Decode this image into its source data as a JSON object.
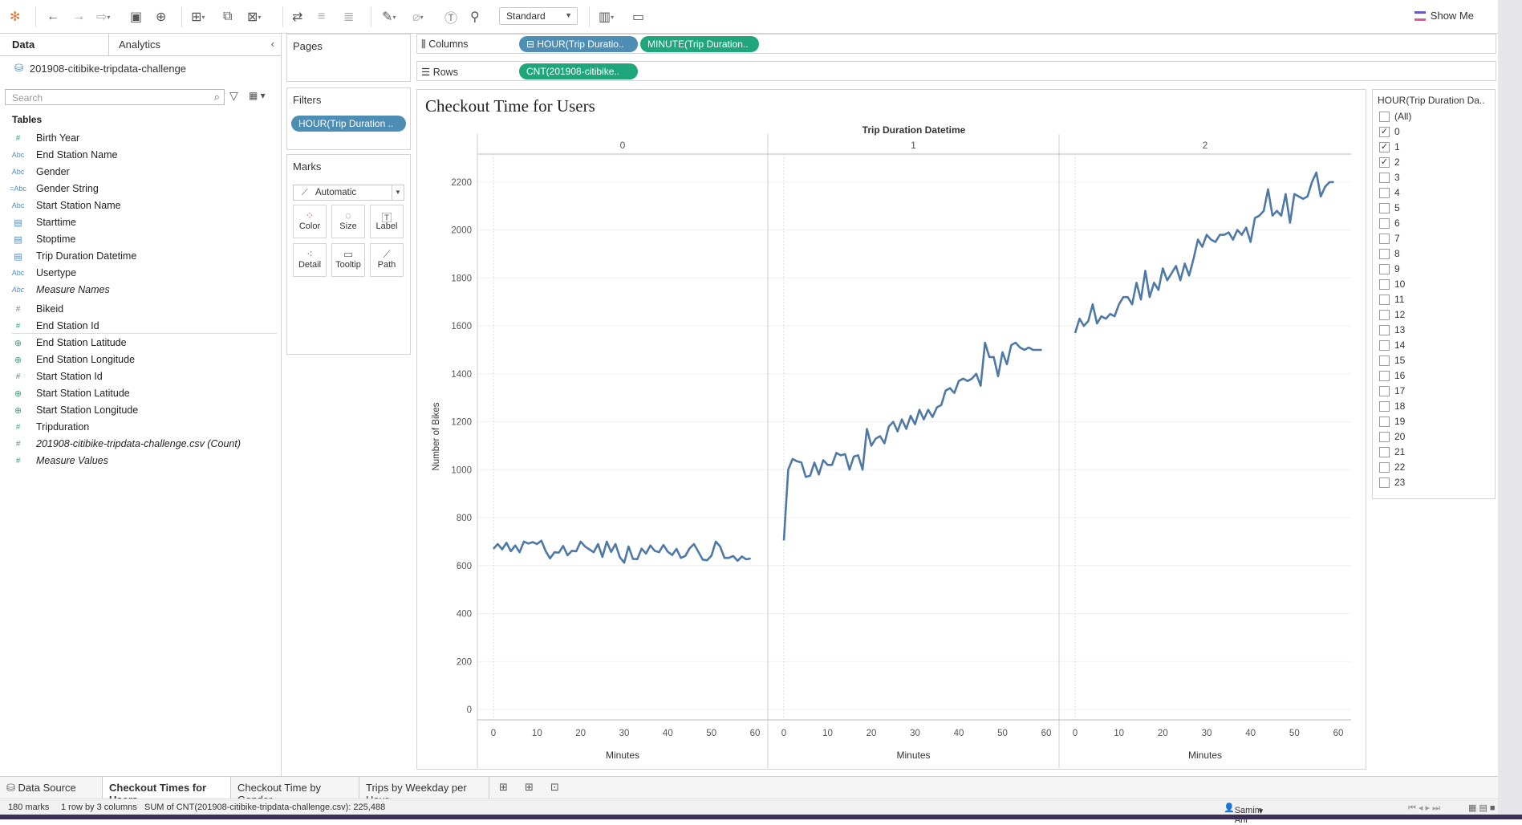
{
  "toolbar": {
    "view_mode": "Standard",
    "show_me": "Show Me"
  },
  "data_pane": {
    "tab_data": "Data",
    "tab_analytics": "Analytics",
    "datasource": "201908-citibike-tripdata-challenge",
    "search_placeholder": "Search",
    "tables_heading": "Tables",
    "dimensions": [
      {
        "name": "Birth Year",
        "type": "#"
      },
      {
        "name": "End Station Name",
        "type": "Abc"
      },
      {
        "name": "Gender",
        "type": "Abc"
      },
      {
        "name": "Gender String",
        "type": "=Abc"
      },
      {
        "name": "Start Station Name",
        "type": "Abc"
      },
      {
        "name": "Starttime",
        "type": "cal"
      },
      {
        "name": "Stoptime",
        "type": "cal"
      },
      {
        "name": "Trip Duration Datetime",
        "type": "cal"
      },
      {
        "name": "Usertype",
        "type": "Abc"
      },
      {
        "name": "Measure Names",
        "type": "Abc"
      }
    ],
    "measures": [
      {
        "name": "Bikeid",
        "type": "#"
      },
      {
        "name": "End Station Id",
        "type": "#"
      },
      {
        "name": "End Station Latitude",
        "type": "globe"
      },
      {
        "name": "End Station Longitude",
        "type": "globe"
      },
      {
        "name": "Start Station Id",
        "type": "#"
      },
      {
        "name": "Start Station Latitude",
        "type": "globe"
      },
      {
        "name": "Start Station Longitude",
        "type": "globe"
      },
      {
        "name": "Tripduration",
        "type": "#"
      },
      {
        "name": "201908-citibike-tripdata-challenge.csv (Count)",
        "type": "#"
      },
      {
        "name": "Measure Values",
        "type": "#"
      }
    ]
  },
  "shelves": {
    "pages_label": "Pages",
    "filters_label": "Filters",
    "filter_pill": "HOUR(Trip Duration ..",
    "marks_label": "Marks",
    "mark_type": "Automatic",
    "mark_buttons": [
      "Color",
      "Size",
      "Label",
      "Detail",
      "Tooltip",
      "Path"
    ],
    "columns_label": "Columns",
    "rows_label": "Rows",
    "column_pills": [
      "⊟ HOUR(Trip Duratio..",
      "MINUTE(Trip Duration.."
    ],
    "row_pills": [
      "CNT(201908-citibike.."
    ]
  },
  "sheet": {
    "title": "Checkout Time for Users"
  },
  "chart_data": {
    "type": "line",
    "title": "Checkout Time for Users",
    "header_title": "Trip Duration Datetime",
    "panels": [
      "0",
      "1",
      "2"
    ],
    "xlabel": "Minutes",
    "ylabel": "Number of Bikes",
    "xlim": [
      0,
      60
    ],
    "xticks": [
      0,
      10,
      20,
      30,
      40,
      50,
      60
    ],
    "ylim": [
      0,
      2300
    ],
    "yticks": [
      0,
      200,
      400,
      600,
      800,
      1000,
      1200,
      1400,
      1600,
      1800,
      2000,
      2200
    ],
    "grid": true,
    "line_color": "#4e79a7",
    "series": [
      {
        "panel": "0",
        "x": [
          0,
          1,
          2,
          3,
          4,
          5,
          6,
          7,
          8,
          9,
          10,
          11,
          12,
          13,
          14,
          15,
          16,
          17,
          18,
          19,
          20,
          21,
          22,
          23,
          24,
          25,
          26,
          27,
          28,
          29,
          30,
          31,
          32,
          33,
          34,
          35,
          36,
          37,
          38,
          39,
          40,
          41,
          42,
          43,
          44,
          45,
          46,
          47,
          48,
          49,
          50,
          51,
          52,
          53,
          54,
          55,
          56,
          57,
          58,
          59
        ],
        "values": [
          670,
          690,
          668,
          695,
          660,
          684,
          656,
          700,
          692,
          698,
          690,
          704,
          660,
          630,
          656,
          654,
          682,
          643,
          662,
          660,
          700,
          680,
          668,
          656,
          690,
          636,
          700,
          657,
          690,
          635,
          612,
          680,
          628,
          627,
          671,
          650,
          684,
          662,
          656,
          686,
          658,
          644,
          670,
          632,
          640,
          672,
          690,
          658,
          625,
          622,
          641,
          700,
          680,
          632,
          632,
          640,
          620,
          638,
          626,
          630
        ]
      },
      {
        "panel": "1",
        "x": [
          0,
          1,
          2,
          3,
          4,
          5,
          6,
          7,
          8,
          9,
          10,
          11,
          12,
          13,
          14,
          15,
          16,
          17,
          18,
          19,
          20,
          21,
          22,
          23,
          24,
          25,
          26,
          27,
          28,
          29,
          30,
          31,
          32,
          33,
          34,
          35,
          36,
          37,
          38,
          39,
          40,
          41,
          42,
          43,
          44,
          45,
          46,
          47,
          48,
          49,
          50,
          51,
          52,
          53,
          54,
          55,
          56,
          57,
          58,
          59
        ],
        "values": [
          705,
          1000,
          1045,
          1035,
          1030,
          970,
          975,
          1030,
          980,
          1040,
          1020,
          1020,
          1070,
          1060,
          1065,
          1000,
          1055,
          1060,
          1000,
          1170,
          1100,
          1130,
          1140,
          1110,
          1180,
          1200,
          1160,
          1210,
          1170,
          1225,
          1190,
          1250,
          1210,
          1250,
          1220,
          1260,
          1270,
          1330,
          1340,
          1320,
          1370,
          1380,
          1370,
          1380,
          1400,
          1350,
          1530,
          1470,
          1470,
          1390,
          1490,
          1440,
          1520,
          1530,
          1510,
          1500,
          1510,
          1500,
          1500,
          1500
        ]
      },
      {
        "panel": "2",
        "x": [
          0,
          1,
          2,
          3,
          4,
          5,
          6,
          7,
          8,
          9,
          10,
          11,
          12,
          13,
          14,
          15,
          16,
          17,
          18,
          19,
          20,
          21,
          22,
          23,
          24,
          25,
          26,
          27,
          28,
          29,
          30,
          31,
          32,
          33,
          34,
          35,
          36,
          37,
          38,
          39,
          40,
          41,
          42,
          43,
          44,
          45,
          46,
          47,
          48,
          49,
          50,
          51,
          52,
          53,
          54,
          55,
          56,
          57,
          58,
          59
        ],
        "values": [
          1570,
          1630,
          1600,
          1620,
          1690,
          1610,
          1640,
          1630,
          1650,
          1640,
          1690,
          1720,
          1720,
          1690,
          1780,
          1710,
          1830,
          1720,
          1780,
          1750,
          1840,
          1790,
          1820,
          1850,
          1790,
          1860,
          1810,
          1880,
          1960,
          1930,
          1980,
          1960,
          1950,
          1980,
          1980,
          1990,
          1960,
          2000,
          1980,
          2010,
          1950,
          2050,
          2060,
          2080,
          2170,
          2060,
          2080,
          2060,
          2150,
          2030,
          2150,
          2140,
          2130,
          2140,
          2200,
          2240,
          2140,
          2180,
          2200,
          2200
        ]
      }
    ]
  },
  "legend": {
    "title": "HOUR(Trip Duration Da..",
    "items": [
      {
        "label": "(All)",
        "checked": false
      },
      {
        "label": "0",
        "checked": true
      },
      {
        "label": "1",
        "checked": true
      },
      {
        "label": "2",
        "checked": true
      },
      {
        "label": "3",
        "checked": false
      },
      {
        "label": "4",
        "checked": false
      },
      {
        "label": "5",
        "checked": false
      },
      {
        "label": "6",
        "checked": false
      },
      {
        "label": "7",
        "checked": false
      },
      {
        "label": "8",
        "checked": false
      },
      {
        "label": "9",
        "checked": false
      },
      {
        "label": "10",
        "checked": false
      },
      {
        "label": "11",
        "checked": false
      },
      {
        "label": "12",
        "checked": false
      },
      {
        "label": "13",
        "checked": false
      },
      {
        "label": "14",
        "checked": false
      },
      {
        "label": "15",
        "checked": false
      },
      {
        "label": "16",
        "checked": false
      },
      {
        "label": "17",
        "checked": false
      },
      {
        "label": "18",
        "checked": false
      },
      {
        "label": "19",
        "checked": false
      },
      {
        "label": "20",
        "checked": false
      },
      {
        "label": "21",
        "checked": false
      },
      {
        "label": "22",
        "checked": false
      },
      {
        "label": "23",
        "checked": false
      }
    ]
  },
  "sheet_tabs": {
    "data_source": "Data Source",
    "tabs": [
      {
        "label": "Checkout Times for Users",
        "active": true
      },
      {
        "label": "Checkout Time by Gender",
        "active": false
      },
      {
        "label": "Trips by Weekday per Hour",
        "active": false
      }
    ]
  },
  "status": {
    "marks": "180 marks",
    "dims": "1 row by 3 columns",
    "sum": "SUM of CNT(201908-citibike-tripdata-challenge.csv): 225,488",
    "user": "Samim Arif"
  }
}
